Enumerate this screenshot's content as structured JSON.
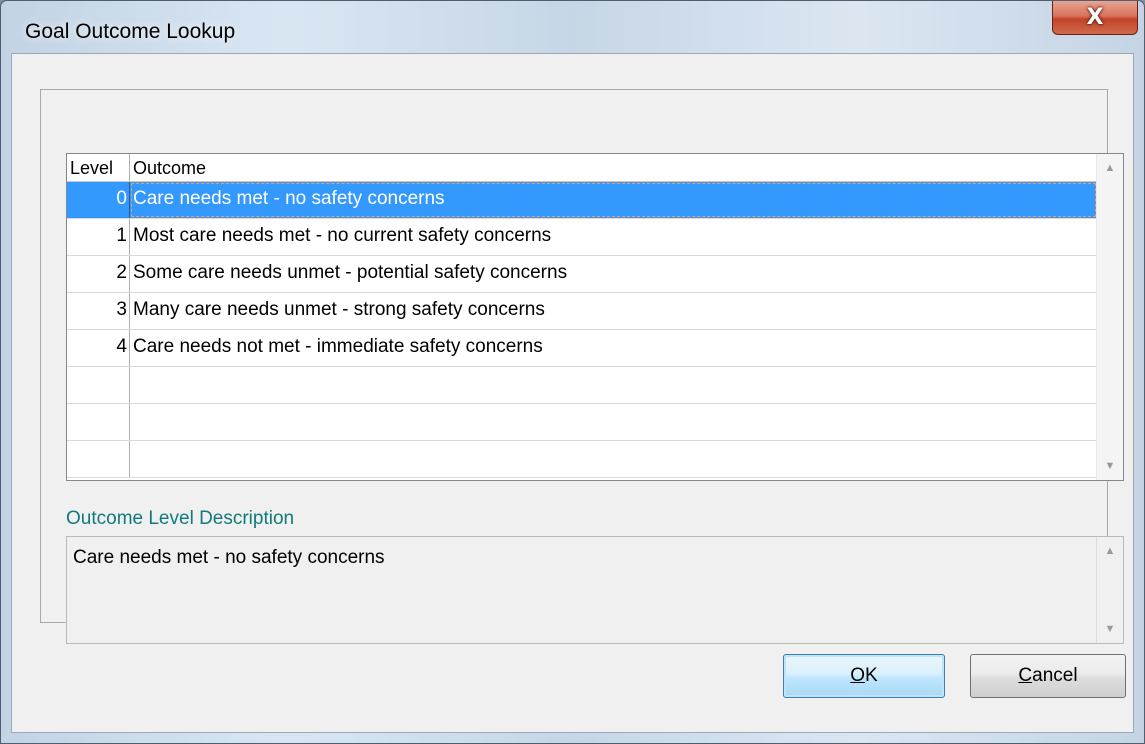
{
  "window": {
    "title": "Goal Outcome Lookup",
    "close_glyph": "X"
  },
  "grid": {
    "headers": {
      "level": "Level",
      "outcome": "Outcome"
    },
    "selected_index": 0,
    "rows": [
      {
        "level": "0",
        "outcome": "Care needs met - no safety concerns"
      },
      {
        "level": "1",
        "outcome": "Most care needs met - no current safety concerns"
      },
      {
        "level": "2",
        "outcome": "Some care needs unmet - potential safety concerns"
      },
      {
        "level": "3",
        "outcome": "Many care needs unmet - strong safety concerns"
      },
      {
        "level": "4",
        "outcome": "Care needs not met - immediate safety concerns"
      },
      {
        "level": "",
        "outcome": ""
      },
      {
        "level": "",
        "outcome": ""
      },
      {
        "level": "",
        "outcome": ""
      }
    ]
  },
  "description": {
    "label": "Outcome Level Description",
    "text": "Care needs met - no safety concerns"
  },
  "buttons": {
    "ok": {
      "mnemonic": "O",
      "rest": "K"
    },
    "cancel": {
      "mnemonic": "C",
      "rest": "ancel"
    }
  },
  "icons": {
    "scroll_up": "scroll-up-icon",
    "scroll_down": "scroll-down-icon",
    "close": "close-icon"
  },
  "colors": {
    "selection": "#3399ff",
    "focus_dash": "#ff9a3c",
    "label_teal": "#117a7a",
    "close_red": "#c2442a"
  }
}
